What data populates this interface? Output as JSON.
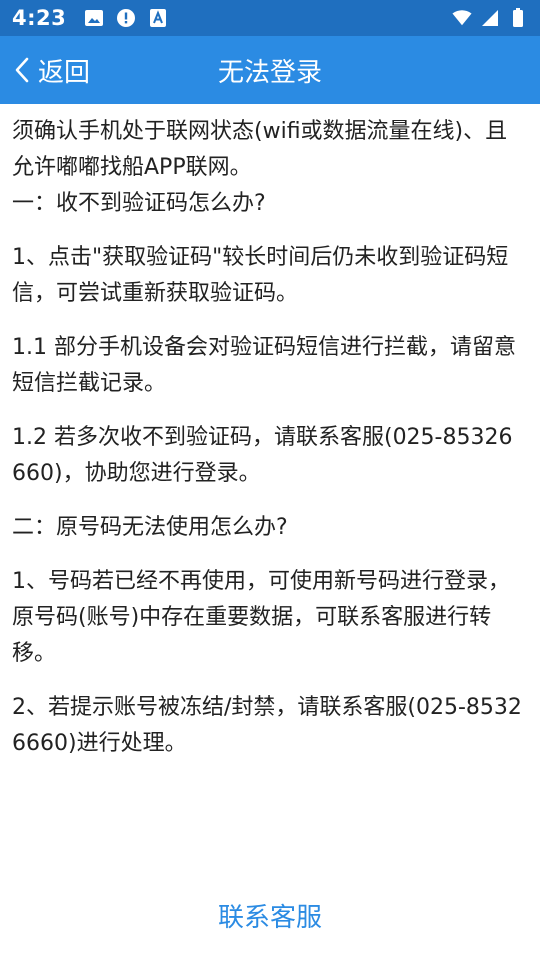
{
  "status_bar": {
    "time": "4:23",
    "icons_left": [
      "image-icon",
      "alert-circle-icon",
      "text-a-icon"
    ],
    "icons_right": [
      "wifi-icon",
      "signal-icon",
      "battery-icon"
    ]
  },
  "header": {
    "back_label": "返回",
    "title": "无法登录"
  },
  "content": {
    "intro": "须确认手机处于联网状态(wifi或数据流量在线)、且允许嘟嘟找船APP联网。",
    "q1_heading": "一：收不到验证码怎么办?",
    "p1": "1、点击\"获取验证码\"较长时间后仍未收到验证码短信，可尝试重新获取验证码。",
    "p1_1": "1.1 部分手机设备会对验证码短信进行拦截，请留意短信拦截记录。",
    "p1_2": "1.2 若多次收不到验证码，请联系客服(025-85326660)，协助您进行登录。",
    "q2_heading": "二：原号码无法使用怎么办?",
    "p2_1": "1、号码若已经不再使用，可使用新号码进行登录，原号码(账号)中存在重要数据，可联系客服进行转移。",
    "p2_2": "2、若提示账号被冻结/封禁，请联系客服(025-85326660)进行处理。"
  },
  "footer": {
    "contact_label": "联系客服"
  },
  "colors": {
    "status_bar": "#1f6fbf",
    "app_bar": "#2b8be3",
    "link": "#2b8be3",
    "text": "#222222"
  }
}
